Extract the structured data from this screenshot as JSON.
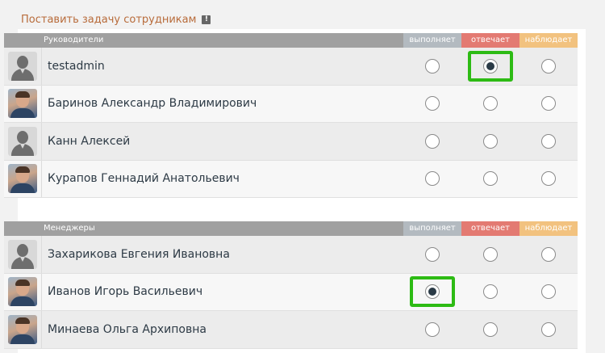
{
  "title": "Поставить задачу сотрудникам",
  "title_icon": "info-icon",
  "columns": {
    "vyp": "выполняет",
    "otv": "отвечает",
    "nab": "наблюдает"
  },
  "colors": {
    "vyp": "#b3bac0",
    "otv": "#e37a72",
    "nab": "#f2c27f",
    "highlight": "#2dbb14",
    "title": "#b86b3a"
  },
  "groups": [
    {
      "name": "Руководители",
      "people": [
        {
          "name": "testadmin",
          "avatar": "default",
          "selected": "otv",
          "highlighted": "otv"
        },
        {
          "name": "Баринов Александр Владимирович",
          "avatar": "photo",
          "selected": null,
          "highlighted": null
        },
        {
          "name": "Канн Алексей",
          "avatar": "default",
          "selected": null,
          "highlighted": null
        },
        {
          "name": "Курапов Геннадий Анатольевич",
          "avatar": "photo",
          "selected": null,
          "highlighted": null
        }
      ]
    },
    {
      "name": "Менеджеры",
      "people": [
        {
          "name": "Захарикова Евгения Ивановна",
          "avatar": "default",
          "selected": null,
          "highlighted": null
        },
        {
          "name": "Иванов Игорь Васильевич",
          "avatar": "photo",
          "selected": "vyp",
          "highlighted": "vyp"
        },
        {
          "name": "Минаева Ольга Архиповна",
          "avatar": "photo",
          "selected": null,
          "highlighted": null
        }
      ]
    }
  ]
}
